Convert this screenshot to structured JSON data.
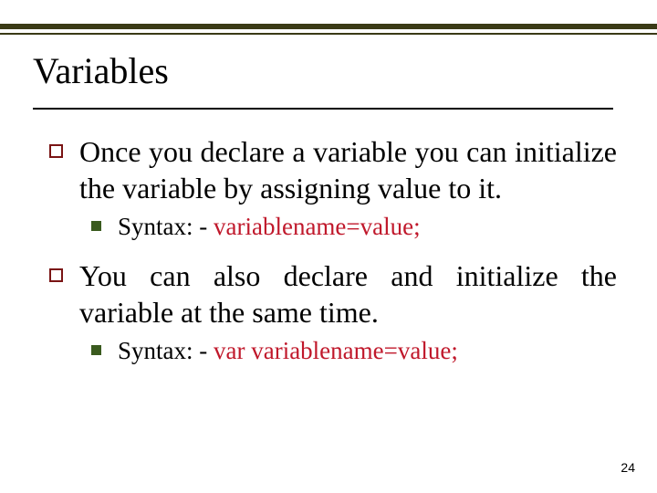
{
  "title": "Variables",
  "bullets": [
    {
      "text": "Once you declare a variable you can initialize the variable by assigning value to it.",
      "sub": [
        {
          "prefix": "Syntax: - ",
          "code": "variablename=value;"
        }
      ]
    },
    {
      "text": "You can also declare and initialize the variable at the same time.",
      "sub": [
        {
          "prefix": "Syntax: - ",
          "code": "var variablename=value;"
        }
      ]
    }
  ],
  "pageNumber": "24"
}
